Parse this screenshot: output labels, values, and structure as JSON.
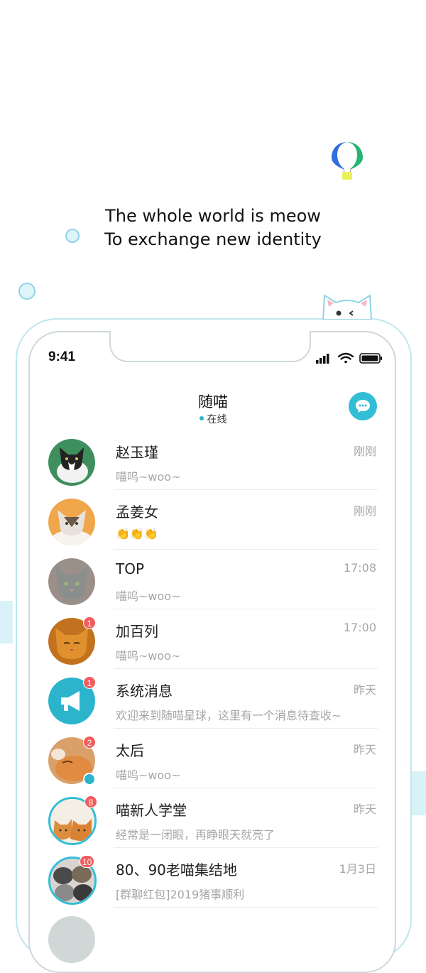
{
  "tagline": {
    "line1": "The whole world is meow",
    "line2": "To exchange new identity"
  },
  "status_bar": {
    "time": "9:41"
  },
  "header": {
    "title": "随喵",
    "status": "在线"
  },
  "conversations": [
    {
      "name": "赵玉瑾",
      "preview": "喵呜~woo~",
      "time": "刚刚",
      "badge": ""
    },
    {
      "name": "孟姜女",
      "preview": "👏👏👏",
      "time": "刚刚",
      "badge": ""
    },
    {
      "name": "TOP",
      "preview": "喵呜~woo~",
      "time": "17:08",
      "badge": ""
    },
    {
      "name": "加百列",
      "preview": "喵呜~woo~",
      "time": "17:00",
      "badge": "1"
    },
    {
      "name": "系统消息",
      "preview": "欢迎来到随喵星球，这里有一个消息待查收~",
      "time": "昨天",
      "badge": "1"
    },
    {
      "name": "太后",
      "preview": "喵呜~woo~",
      "time": "昨天",
      "badge": "2"
    },
    {
      "name": "喵新人学堂",
      "preview": "经常是一闭眼，再睁眼天就亮了",
      "time": "昨天",
      "badge": "8"
    },
    {
      "name": "80、90老喵集结地",
      "preview": "[群聊红包]2019猪事顺利",
      "time": "1月3日",
      "badge": "10"
    }
  ],
  "colors": {
    "accent": "#33bdd6",
    "badge": "#f25c5c",
    "muted_text": "#a6a6a6"
  }
}
